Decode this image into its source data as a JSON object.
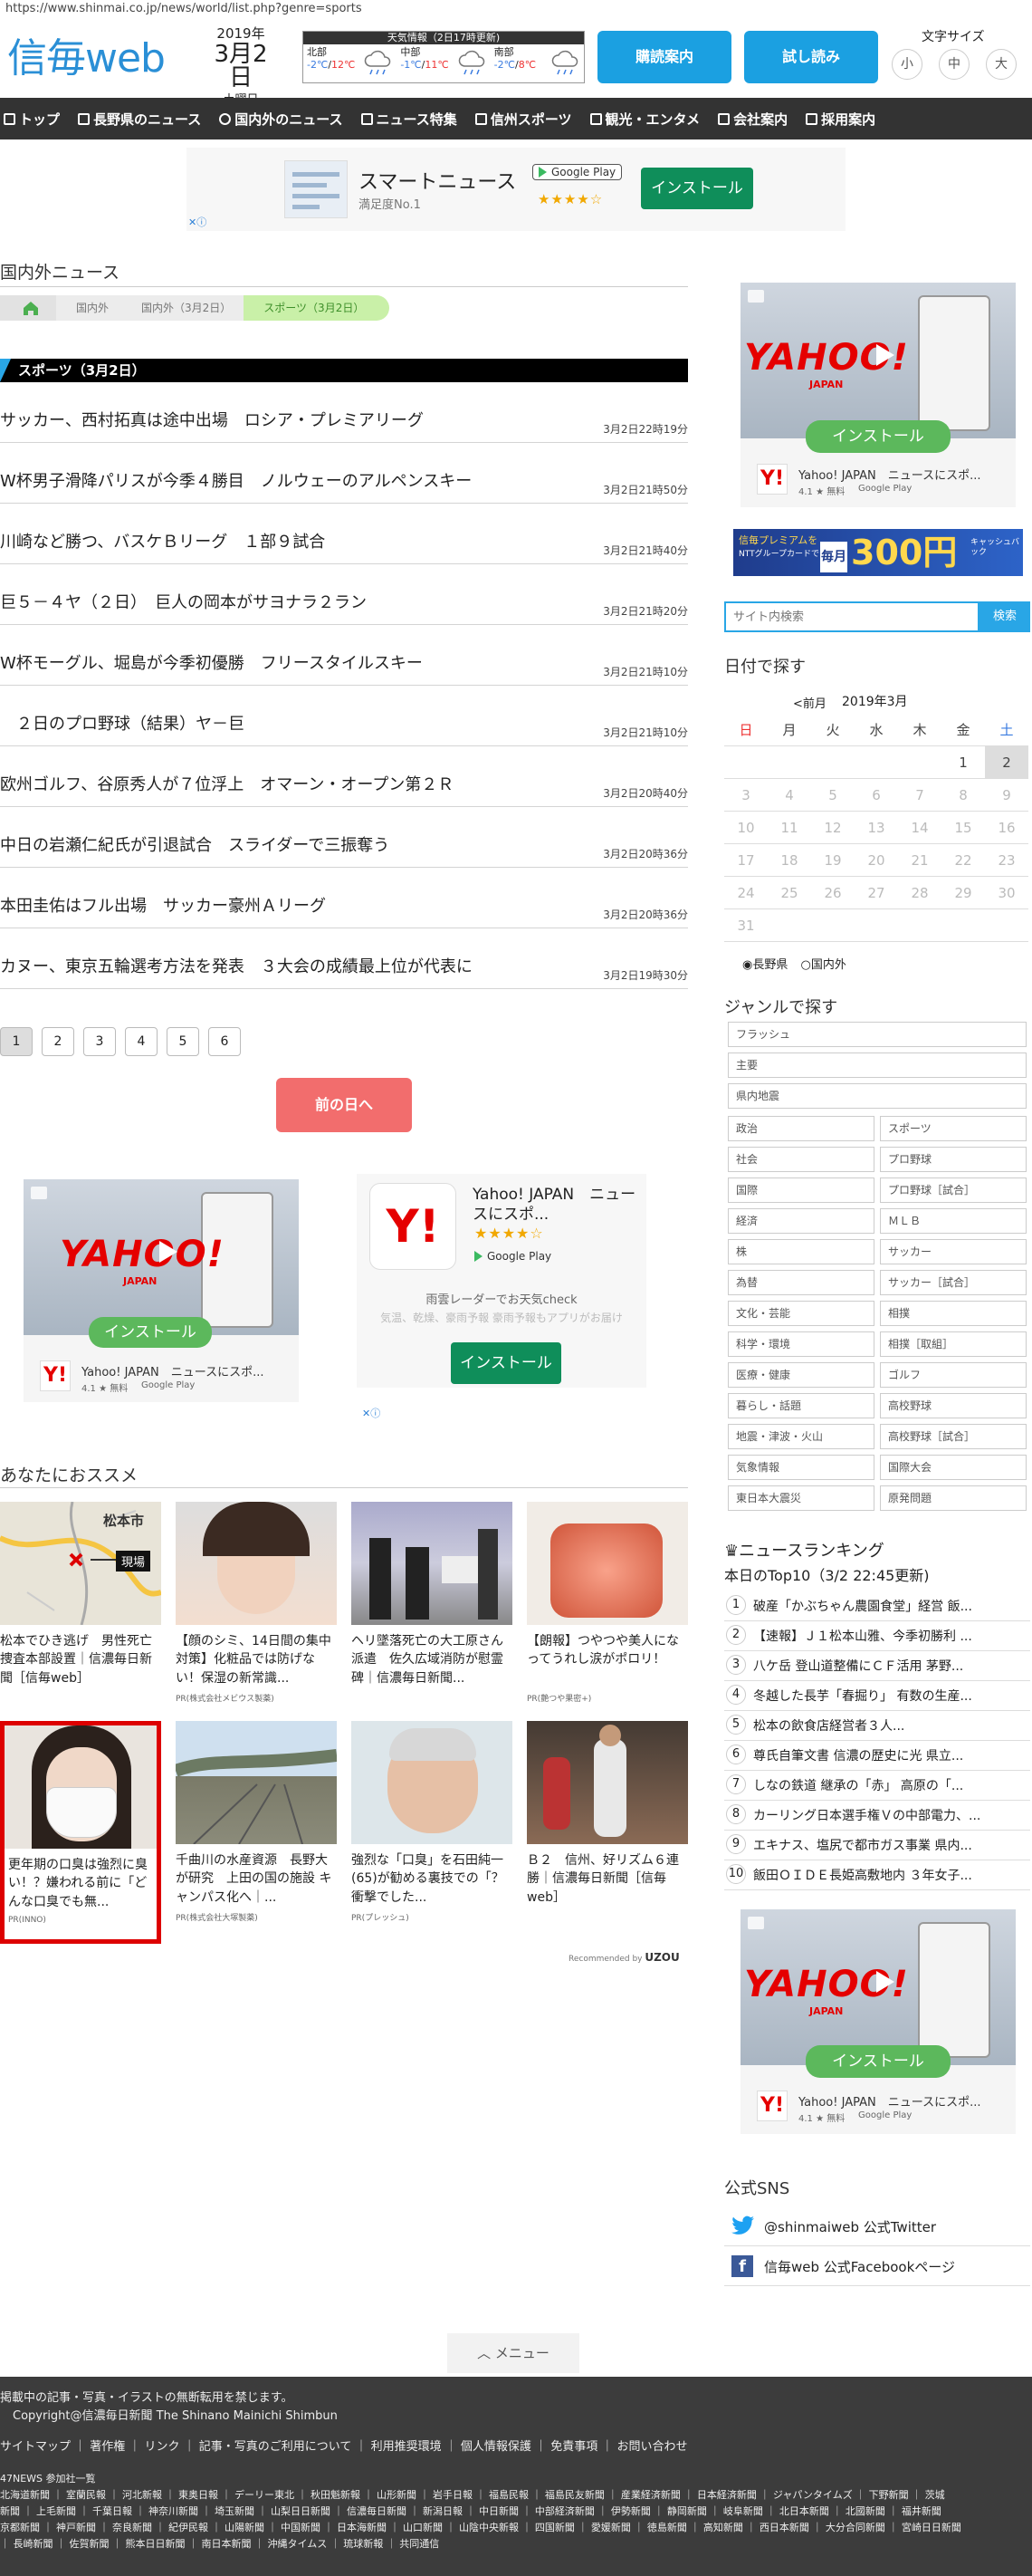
{
  "url": "https://www.shinmai.co.jp/news/world/list.php?genre=sports",
  "header": {
    "logo": "信毎web",
    "year": "2019年",
    "month_day": "3月2日",
    "weekday": "土曜日",
    "weather_title": "天気情報（2日17時更新)",
    "weather": [
      {
        "area": "北部",
        "lo": "-2℃",
        "hi": "12℃"
      },
      {
        "area": "中部",
        "lo": "-1℃",
        "hi": "11℃"
      },
      {
        "area": "南部",
        "lo": "-2℃",
        "hi": "8℃"
      }
    ],
    "btn_delivery": "購読案内",
    "btn_trial": "試し読み",
    "font_size_label": "文字サイズ",
    "font_sizes": [
      "小",
      "中",
      "大"
    ]
  },
  "nav": [
    "トップ",
    "長野県のニュース",
    "国内外のニュース",
    "ニュース特集",
    "信州スポーツ",
    "観光・エンタメ",
    "会社案内",
    "採用案内"
  ],
  "top_ad": {
    "title": "スマートニュース",
    "sub": "満足度No.1",
    "store": "Google Play",
    "stars": "★★★★☆",
    "button": "インストール"
  },
  "main": {
    "section_title": "国内外ニュース",
    "breadcrumb": [
      "国内外",
      "国内外（3月2日）",
      "スポーツ（3月2日）"
    ],
    "category": "スポーツ（3月2日）",
    "news": [
      {
        "title": "サッカー、西村拓真は途中出場　ロシア・プレミアリーグ",
        "time": "3月2日22時19分"
      },
      {
        "title": "W杯男子滑降パリスが今季４勝目　ノルウェーのアルペンスキー",
        "time": "3月2日21時50分"
      },
      {
        "title": "川崎など勝つ、バスケＢリーグ　１部９試合",
        "time": "3月2日21時40分"
      },
      {
        "title": "巨５－４ヤ（２日）　巨人の岡本がサヨナラ２ラン",
        "time": "3月2日21時20分"
      },
      {
        "title": "W杯モーグル、堀島が今季初優勝　フリースタイルスキー",
        "time": "3月2日21時10分"
      },
      {
        "title": "　２日のプロ野球（結果）ヤ－巨",
        "time": "3月2日21時10分"
      },
      {
        "title": "欧州ゴルフ、谷原秀人が７位浮上　オマーン・オープン第２Ｒ",
        "time": "3月2日20時40分"
      },
      {
        "title": "中日の岩瀬仁紀氏が引退試合　スライダーで三振奪う",
        "time": "3月2日20時36分"
      },
      {
        "title": "本田圭佑はフル出場　サッカー豪州Ａリーグ",
        "time": "3月2日20時36分"
      },
      {
        "title": "カヌー、東京五輪選考方法を発表　３大会の成績最上位が代表に",
        "time": "3月2日19時30分"
      }
    ],
    "pages": [
      "1",
      "2",
      "3",
      "4",
      "5",
      "6"
    ],
    "prev_day": "前の日へ"
  },
  "yahoo_ad": {
    "brand": "YAHOO!",
    "brand_sub": "JAPAN",
    "install": "インストール",
    "app_name": "Yahoo! JAPAN　ニュースにスポ...",
    "rating": "4.1 ★ 無料",
    "store": "Google Play",
    "ad_title": "Yahoo! JAPAN　ニュースにスポ...",
    "ad_stars": "★★★★☆",
    "ad_desc_1": "雨雲レーダーでお天気check",
    "ad_desc_2": "気温、乾燥、豪雨予報 豪雨予報もアプリがお届け",
    "ad_button": "インストール"
  },
  "recommend": {
    "title": "あなたにおススメ",
    "items": [
      {
        "cap": "松本でひき逃げ　男性死亡　捜査本部設置｜信濃毎日新聞［信毎web］",
        "pr": "",
        "map_label_1": "松本市",
        "map_label_2": "現場"
      },
      {
        "cap": "【顔のシミ、14日間の集中対策】化粧品では防げない！保湿の新常識...",
        "pr": "PR(株式会社メビウス製薬)"
      },
      {
        "cap": "ヘリ墜落死亡の大工原さん派遣　佐久広域消防が慰霊碑｜信濃毎日新聞...",
        "pr": ""
      },
      {
        "cap": "【朗報】つやつや美人になってうれし涙がポロリ！",
        "pr": "PR(艶つや果密+)"
      },
      {
        "cap": "更年期の口臭は強烈に臭い！？嫌われる前に「どんな口臭でも無...",
        "pr": "PR(INNO)"
      },
      {
        "cap": "千曲川の水産資源　長野大が研究　上田の国の施設 キャンパス化へ｜...",
        "pr": "PR(株式会社大塚製薬)"
      },
      {
        "cap": "強烈な「口臭」を石田純一(65)が勧める裏技での「？衝撃でした...",
        "pr": "PR(プレッシュ)"
      },
      {
        "cap": "Ｂ２　信州、好リズム６連勝｜信濃毎日新聞［信毎web］",
        "pr": ""
      }
    ],
    "credit": "Recommended by",
    "credit_brand": "UZOU"
  },
  "sidebar": {
    "premium_line1": "信毎プレミアムを",
    "premium_line2": "NTTグループカードで",
    "premium_line3": "毎月",
    "premium_big": "300円",
    "premium_tail": "キャッシュバック",
    "search_placeholder": "サイト内検索",
    "search_button": "検索",
    "date_title": "日付で探す",
    "cal_prev": "<前月",
    "cal_month": "2019年3月",
    "cal_head": [
      "日",
      "月",
      "火",
      "水",
      "木",
      "金",
      "土"
    ],
    "cal_weeks": [
      [
        "",
        "",
        "",
        "",
        "",
        "1",
        "2"
      ],
      [
        "3",
        "4",
        "5",
        "6",
        "7",
        "8",
        "9"
      ],
      [
        "10",
        "11",
        "12",
        "13",
        "14",
        "15",
        "16"
      ],
      [
        "17",
        "18",
        "19",
        "20",
        "21",
        "22",
        "23"
      ],
      [
        "24",
        "25",
        "26",
        "27",
        "28",
        "29",
        "30"
      ],
      [
        "31",
        "",
        "",
        "",
        "",
        "",
        ""
      ]
    ],
    "radio": [
      "長野県",
      "国内外"
    ],
    "genre_title": "ジャンルで探す",
    "genre_full": [
      "フラッシュ",
      "主要",
      "県内地震"
    ],
    "genre_pairs": [
      [
        "政治",
        "スポーツ"
      ],
      [
        "社会",
        "プロ野球"
      ],
      [
        "国際",
        "プロ野球［試合］"
      ],
      [
        "経済",
        "ＭＬＢ"
      ],
      [
        "株",
        "サッカー"
      ],
      [
        "為替",
        "サッカー［試合］"
      ],
      [
        "文化・芸能",
        "相撲"
      ],
      [
        "科学・環境",
        "相撲［取組］"
      ],
      [
        "医療・健康",
        "ゴルフ"
      ],
      [
        "暮らし・話題",
        "高校野球"
      ],
      [
        "地震・津波・火山",
        "高校野球［試合］"
      ],
      [
        "気象情報",
        "国際大会"
      ],
      [
        "東日本大震災",
        "原発問題"
      ]
    ],
    "ranking_title": "ニュースランキング",
    "ranking_sub": "本日のTop10（3/2 22:45更新)",
    "ranking": [
      "破産「かぶちゃん農園食堂」経営 飯...",
      "【速報】Ｊ１松本山雅、今季初勝利 ...",
      "八ケ岳 登山道整備にＣＦ活用 茅野...",
      "冬越した長芋「春掘り」 有数の生産...",
      "松本の飲食店経営者３人...",
      "尊氏自筆文書 信濃の歴史に光 県立...",
      "しなの鉄道 継承の「赤」 高原の「...",
      "カーリング日本選手権Ｖの中部電力、...",
      "エキナス、塩尻で都市ガス事業 県内...",
      "飯田ＯＩＤＥ長姫高敷地内 ３年女子..."
    ],
    "sns_title": "公式SNS",
    "sns": [
      "@shinmaiweb 公式Twitter",
      "信毎web 公式Facebookページ"
    ]
  },
  "menu_button": "メニュー",
  "footer": {
    "notice": "掲載中の記事・写真・イラストの無断転用を禁じます。",
    "copyright": "Copyright@信濃毎日新聞 The Shinano Mainichi Shimbun",
    "links": "サイトマップ ｜ 著作権 ｜ リンク ｜ 記事・写真のご利用について ｜ 利用推奨環境 ｜ 個人情報保護 ｜ 免責事項 ｜ お問い合わせ",
    "members_title": "47NEWS 参加社一覧",
    "members_1": "北海道新聞 ｜ 室蘭民報 ｜ 河北新報 ｜ 東奥日報 ｜ デーリー東北 ｜ 秋田魁新報 ｜ 山形新聞 ｜ 岩手日報 ｜ 福島民報 ｜ 福島民友新聞 ｜ 産業経済新聞 ｜ 日本経済新聞 ｜ ジャパンタイムズ ｜ 下野新聞 ｜ 茨城",
    "members_2": "新聞 ｜ 上毛新聞 ｜ 千葉日報 ｜ 神奈川新聞 ｜ 埼玉新聞 ｜ 山梨日日新聞 ｜ 信濃毎日新聞 ｜ 新潟日報 ｜ 中日新聞 ｜ 中部経済新聞 ｜ 伊勢新聞 ｜ 静岡新聞 ｜ 岐阜新聞 ｜ 北日本新聞 ｜ 北國新聞 ｜ 福井新聞",
    "members_3": "京都新聞 ｜ 神戸新聞 ｜ 奈良新聞 ｜ 紀伊民報 ｜ 山陽新聞 ｜ 中国新聞 ｜ 日本海新聞 ｜ 山口新聞 ｜ 山陰中央新報 ｜ 四国新聞 ｜ 愛媛新聞 ｜ 徳島新聞 ｜ 高知新聞 ｜ 西日本新聞 ｜ 大分合同新聞 ｜ 宮崎日日新聞",
    "members_4": "｜ 長崎新聞 ｜ 佐賀新聞 ｜ 熊本日日新聞 ｜ 南日本新聞 ｜ 沖縄タイムス ｜ 琉球新報 ｜ 共同通信"
  }
}
